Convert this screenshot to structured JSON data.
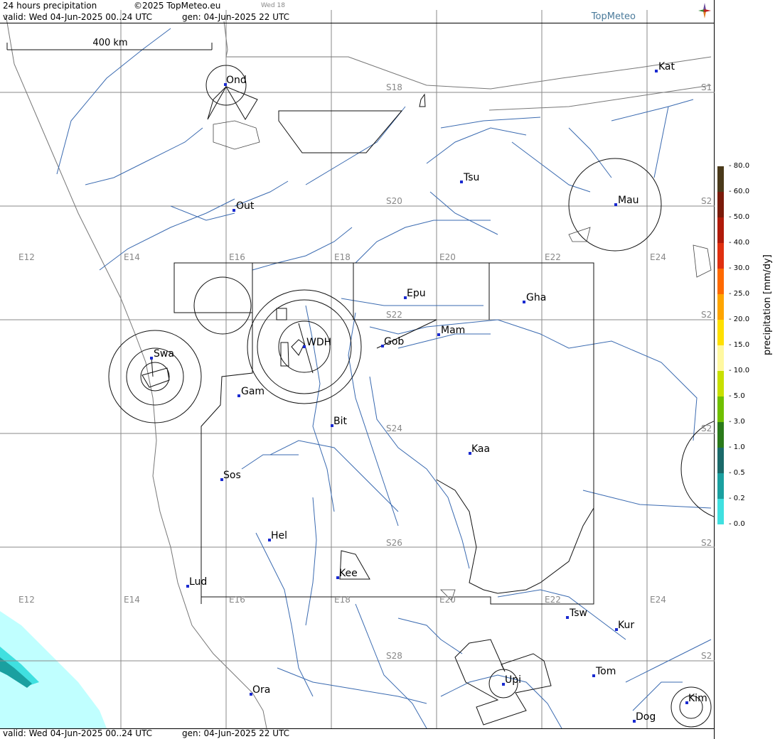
{
  "header": {
    "product": "24 hours precipitation",
    "copyright": "©2025 TopMeteo.eu",
    "day_tag": "Wed 18",
    "valid": "valid:  Wed  04-Jun-2025  00..24 UTC",
    "generated": "gen: 04-Jun-2025 22 UTC",
    "brand": "TopMeteo"
  },
  "footer": {
    "valid": "valid:  Wed  04-Jun-2025  00..24 UTC",
    "generated": "gen: 04-Jun-2025 22 UTC"
  },
  "scale_bar": {
    "label": "400 km"
  },
  "grid_labels": {
    "lon_top": [
      "E12",
      "E14",
      "E16",
      "E18",
      "E20",
      "E22",
      "E24"
    ],
    "lon_bottom": [
      "E12",
      "E14",
      "E16",
      "E18",
      "E20",
      "E22",
      "E24"
    ],
    "lat_mid": [
      "S18",
      "S20",
      "S22",
      "S24",
      "S26",
      "S28"
    ],
    "lat_right": [
      "S1",
      "S2",
      "S2",
      "S2",
      "S2",
      "S2"
    ]
  },
  "cities": [
    {
      "code": "Ond"
    },
    {
      "code": "Kat"
    },
    {
      "code": "Tsu"
    },
    {
      "code": "Out"
    },
    {
      "code": "Mau"
    },
    {
      "code": "Epu"
    },
    {
      "code": "Gha"
    },
    {
      "code": "Mam"
    },
    {
      "code": "WDH"
    },
    {
      "code": "Gob"
    },
    {
      "code": "Swa"
    },
    {
      "code": "Gam"
    },
    {
      "code": "Bit"
    },
    {
      "code": "Kaa"
    },
    {
      "code": "Sos"
    },
    {
      "code": "Hel"
    },
    {
      "code": "Kee"
    },
    {
      "code": "Lud"
    },
    {
      "code": "Tsw"
    },
    {
      "code": "Kur"
    },
    {
      "code": "Tom"
    },
    {
      "code": "Upi"
    },
    {
      "code": "Ora"
    },
    {
      "code": "Kim"
    },
    {
      "code": "Dog"
    }
  ],
  "legend": {
    "title": "precipitation  [mm/dy]",
    "levels": [
      "80.0",
      "60.0",
      "50.0",
      "40.0",
      "30.0",
      "25.0",
      "20.0",
      "15.0",
      "10.0",
      "5.0",
      "3.0",
      "1.0",
      "0.5",
      "0.2",
      "0.0"
    ],
    "colors": [
      "#4a3a1a",
      "#7a1a0a",
      "#b01a0a",
      "#e03010",
      "#ff6a00",
      "#ffa500",
      "#ffe000",
      "#fff8a0",
      "#c8e000",
      "#70c000",
      "#2a7a1a",
      "#1a6a6a",
      "#1aa0a0",
      "#40e0e0",
      "#c0ffff"
    ]
  },
  "precip_colors": {
    "light": "#c0ffff",
    "medium": "#40e0e0",
    "strong": "#1aa0a0"
  }
}
